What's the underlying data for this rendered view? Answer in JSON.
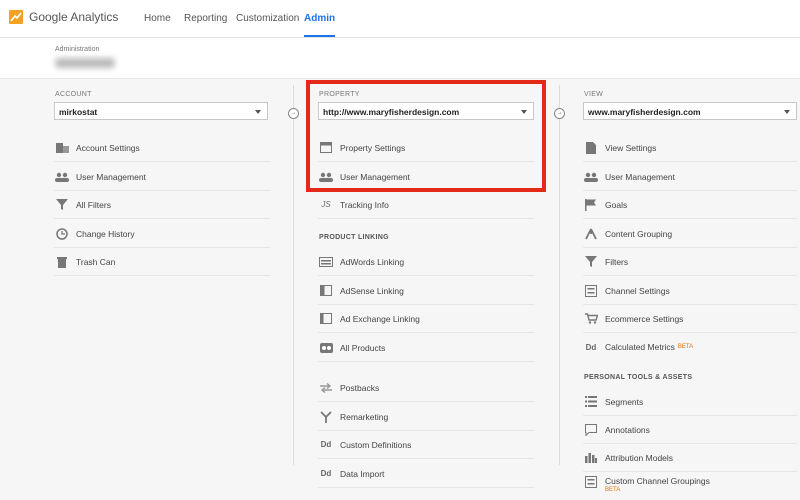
{
  "app": {
    "logo_text": "Google Analytics"
  },
  "nav": [
    {
      "label": "Home"
    },
    {
      "label": "Reporting"
    },
    {
      "label": "Customization"
    },
    {
      "label": "Admin"
    }
  ],
  "admin": {
    "label": "Administration"
  },
  "account": {
    "heading": "ACCOUNT",
    "selected": "mirkostat",
    "items": [
      {
        "label": "Account Settings",
        "icon": "building-icon"
      },
      {
        "label": "User Management",
        "icon": "users-icon"
      },
      {
        "label": "All Filters",
        "icon": "filter-icon"
      },
      {
        "label": "Change History",
        "icon": "history-icon"
      },
      {
        "label": "Trash Can",
        "icon": "trash-icon"
      }
    ]
  },
  "property": {
    "heading": "PROPERTY",
    "selected": "http://www.maryfisherdesign.com",
    "items": [
      {
        "label": "Property Settings",
        "icon": "window-icon"
      },
      {
        "label": "User Management",
        "icon": "users-icon"
      },
      {
        "label": "Tracking Info",
        "icon": "js-icon",
        "glyph": "JS"
      }
    ],
    "product_linking_heading": "PRODUCT LINKING",
    "linking_items": [
      {
        "label": "AdWords Linking",
        "icon": "adwords-icon"
      },
      {
        "label": "AdSense Linking",
        "icon": "adsense-icon"
      },
      {
        "label": "Ad Exchange Linking",
        "icon": "adexchange-icon"
      },
      {
        "label": "All Products",
        "icon": "products-icon"
      }
    ],
    "other_items": [
      {
        "label": "Postbacks",
        "icon": "postbacks-icon"
      },
      {
        "label": "Remarketing",
        "icon": "remarketing-icon"
      },
      {
        "label": "Custom Definitions",
        "icon": "dd-icon",
        "glyph": "Dd"
      },
      {
        "label": "Data Import",
        "icon": "dd-icon",
        "glyph": "Dd"
      }
    ]
  },
  "view": {
    "heading": "VIEW",
    "selected": "www.maryfisherdesign.com",
    "items": [
      {
        "label": "View Settings",
        "icon": "document-icon"
      },
      {
        "label": "User Management",
        "icon": "users-icon"
      },
      {
        "label": "Goals",
        "icon": "flag-icon"
      },
      {
        "label": "Content Grouping",
        "icon": "grouping-icon"
      },
      {
        "label": "Filters",
        "icon": "filter-icon"
      },
      {
        "label": "Channel Settings",
        "icon": "channel-icon"
      },
      {
        "label": "Ecommerce Settings",
        "icon": "cart-icon"
      },
      {
        "label": "Calculated Metrics",
        "icon": "dd-icon",
        "glyph": "Dd",
        "badge": "BETA"
      }
    ],
    "personal_heading": "PERSONAL TOOLS & ASSETS",
    "personal_items": [
      {
        "label": "Segments",
        "icon": "segments-icon"
      },
      {
        "label": "Annotations",
        "icon": "annotation-icon"
      },
      {
        "label": "Attribution Models",
        "icon": "bars-icon"
      },
      {
        "label": "Custom Channel Groupings",
        "icon": "channel-icon",
        "badge": "BETA"
      }
    ]
  },
  "colors": {
    "accent": "#1a73e8",
    "highlight": "#e32a19",
    "beta": "#e8710a"
  }
}
